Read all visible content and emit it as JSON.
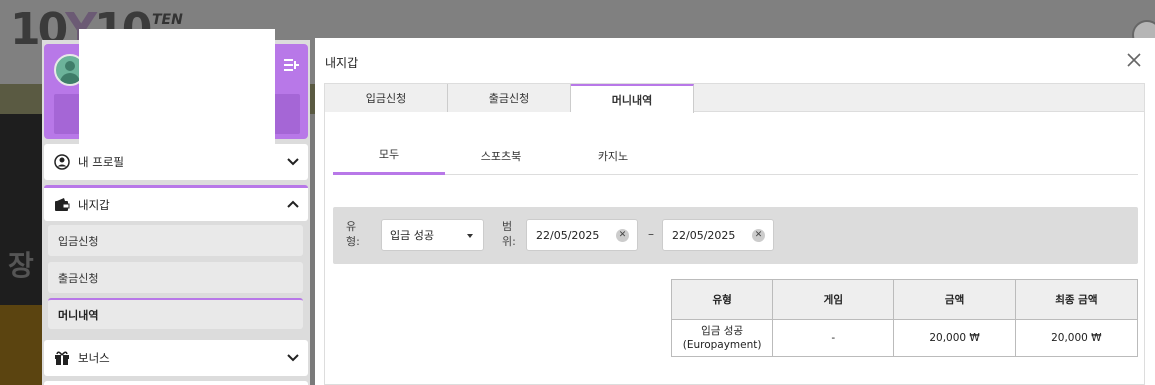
{
  "background": {
    "logo_text": "10",
    "logo_y": "Y",
    "logo_tail": "10",
    "logo_sub": "TEN",
    "side_glyph": "장"
  },
  "sidebar": {
    "items": [
      {
        "label": "내 프로필",
        "icon": "user-circle-icon",
        "expanded": false
      },
      {
        "label": "내지갑",
        "icon": "wallet-icon",
        "expanded": true
      },
      {
        "label": "보너스",
        "icon": "gift-icon",
        "expanded": false
      }
    ],
    "wallet_subitems": [
      {
        "label": "입금신청"
      },
      {
        "label": "출금신청"
      },
      {
        "label": "머니내역"
      }
    ]
  },
  "modal": {
    "title": "내지갑",
    "tabs": [
      {
        "label": "입금신청"
      },
      {
        "label": "출금신청"
      },
      {
        "label": "머니내역"
      }
    ],
    "subtabs": [
      {
        "label": "모두"
      },
      {
        "label": "스포츠북"
      },
      {
        "label": "카지노"
      }
    ],
    "filter": {
      "type_label_1": "유",
      "type_label_2": "형:",
      "type_value": "입금 성공",
      "range_label_1": "범",
      "range_label_2": "위:",
      "date_from": "22/05/2025",
      "date_to": "22/05/2025",
      "dash": "–"
    },
    "table": {
      "headers": [
        "유형",
        "게임",
        "금액",
        "최종 금액"
      ],
      "rows": [
        {
          "type_line1": "입금 성공",
          "type_line2": "(Europayment)",
          "game": "-",
          "amount": "20,000 ₩",
          "final_amount": "20,000 ₩"
        }
      ]
    }
  },
  "colors": {
    "accent": "#b878e8"
  }
}
